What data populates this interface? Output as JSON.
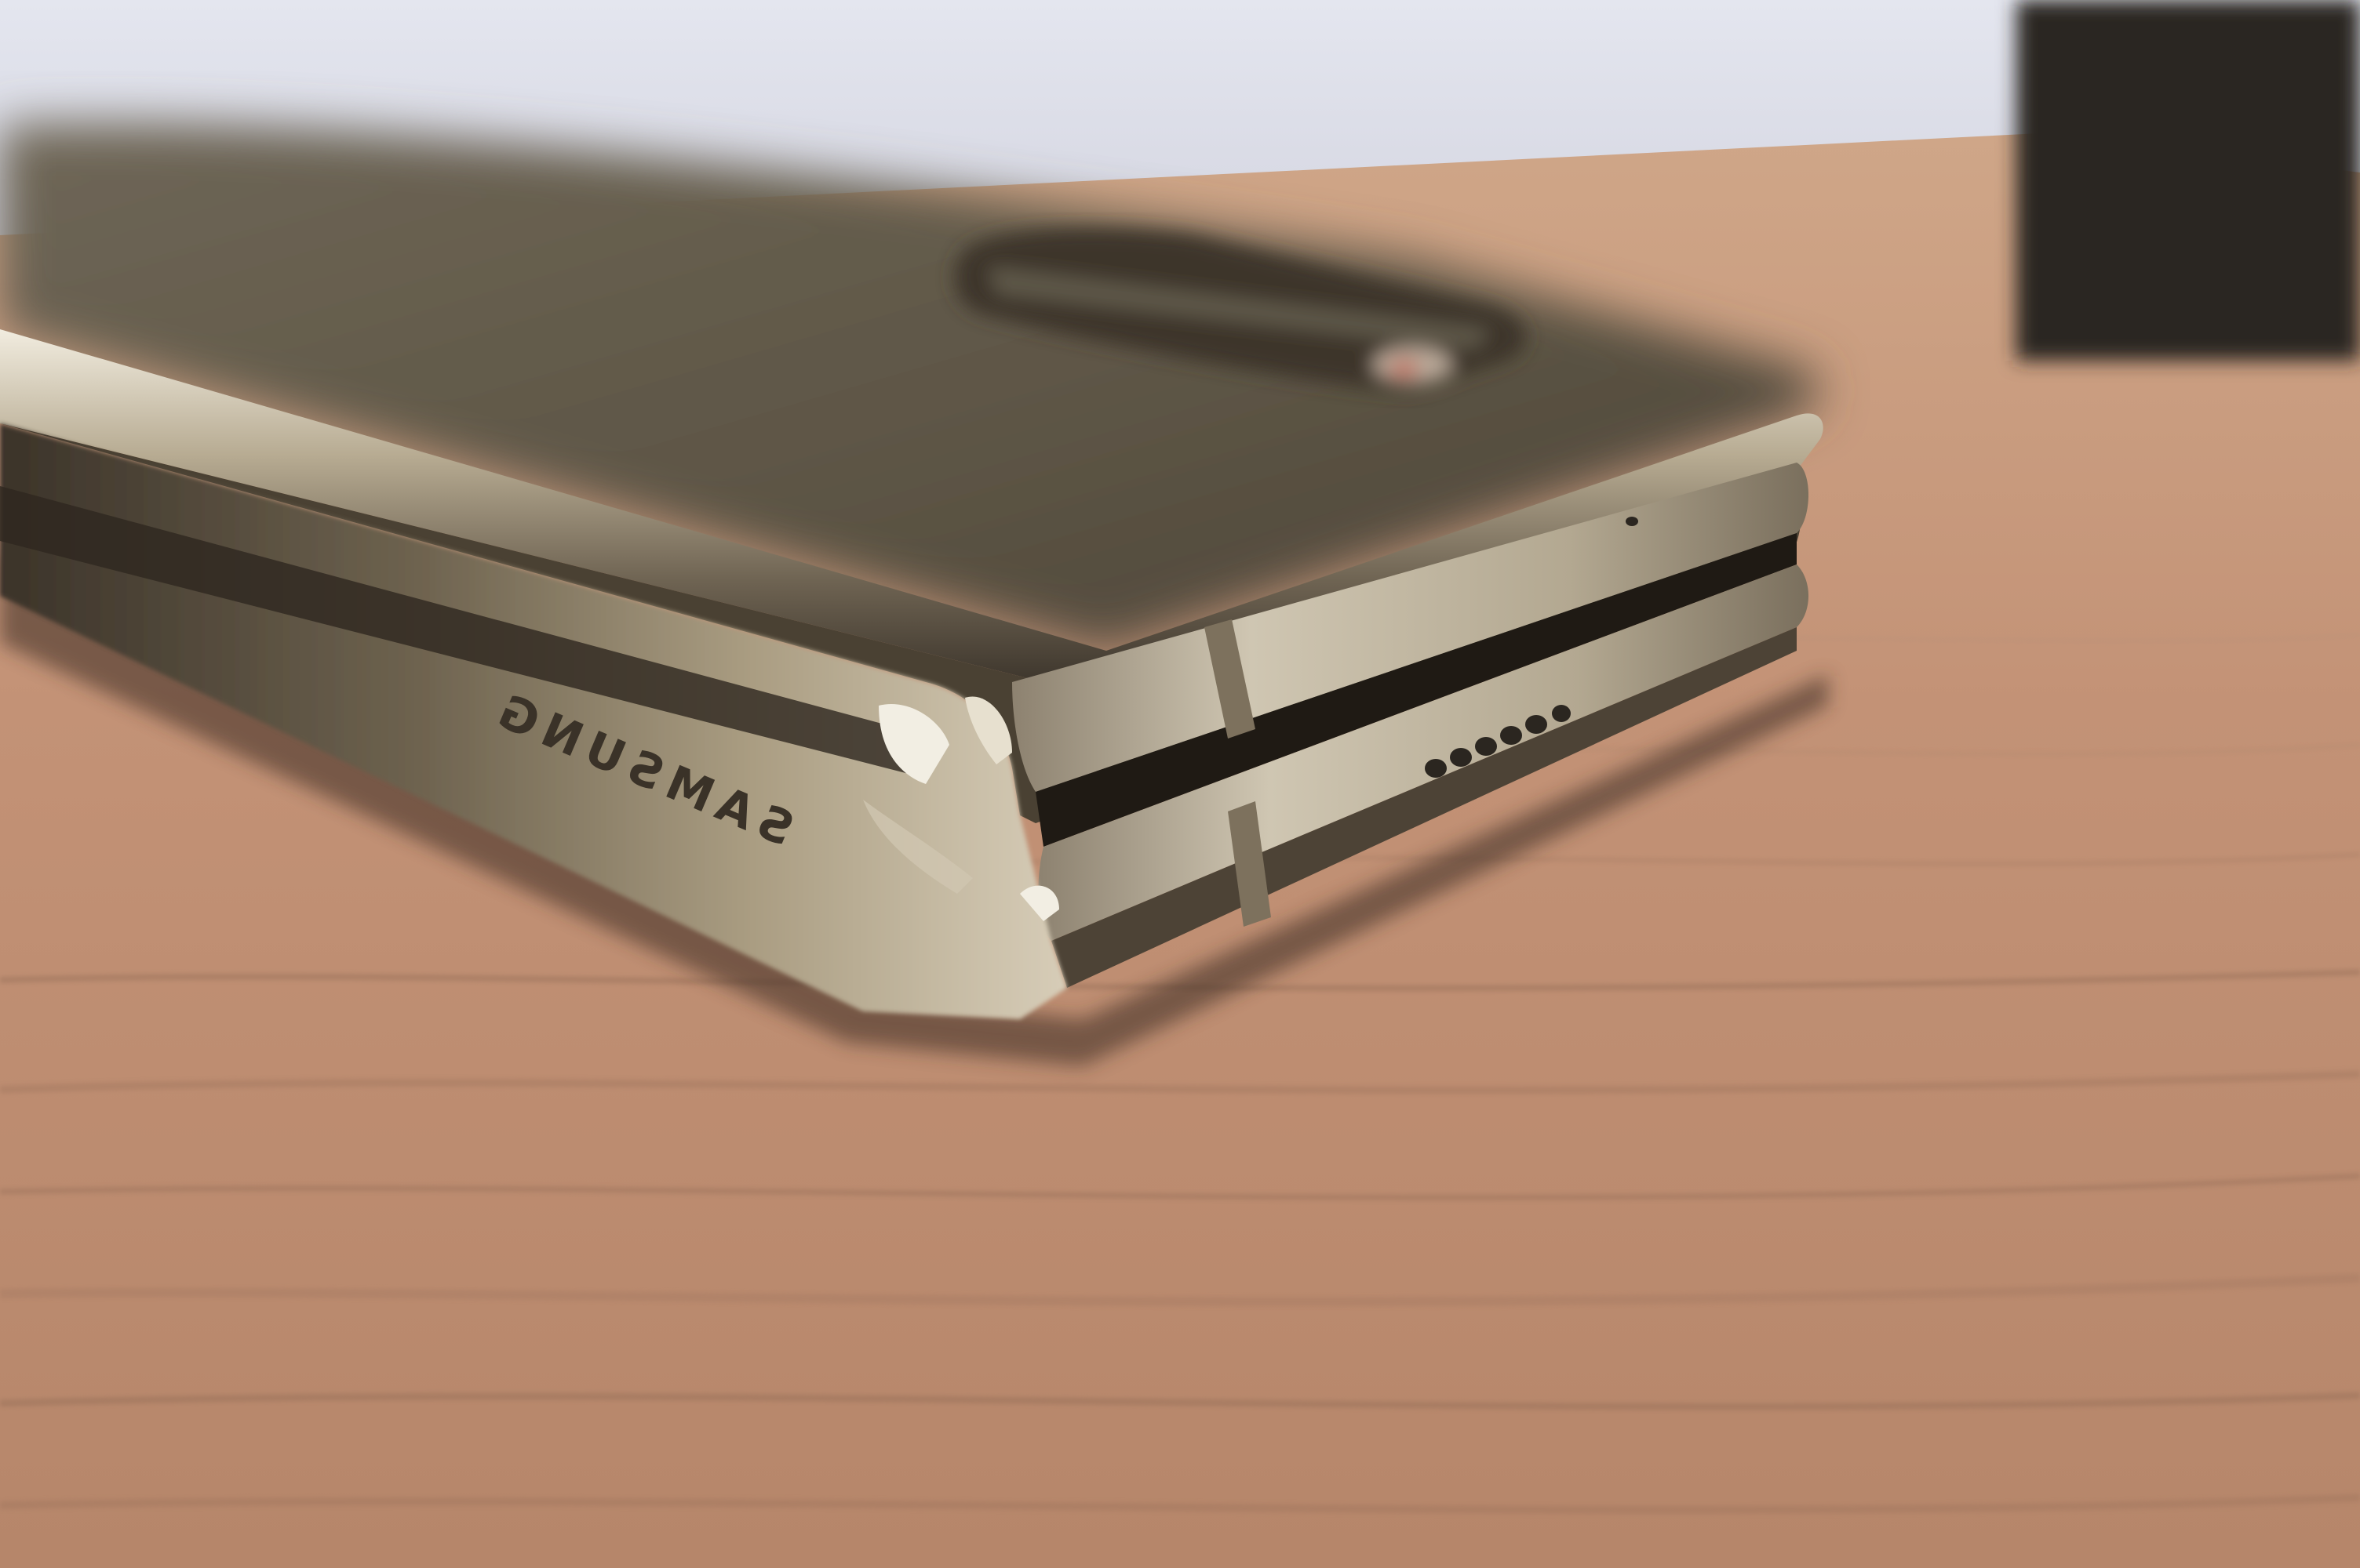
{
  "photo": {
    "subject": "folded-phone-on-wooden-table",
    "brand_engraving": "SAMSUNG",
    "colors": {
      "wall": "#dcdfea",
      "table_light": "#c99a7c",
      "table_dark": "#7a5a47",
      "phone_body": "#5a5244",
      "chrome_highlight": "#e9e4d6",
      "speaker_holes": "#2b2620",
      "object_dark": "#2a2620"
    }
  }
}
